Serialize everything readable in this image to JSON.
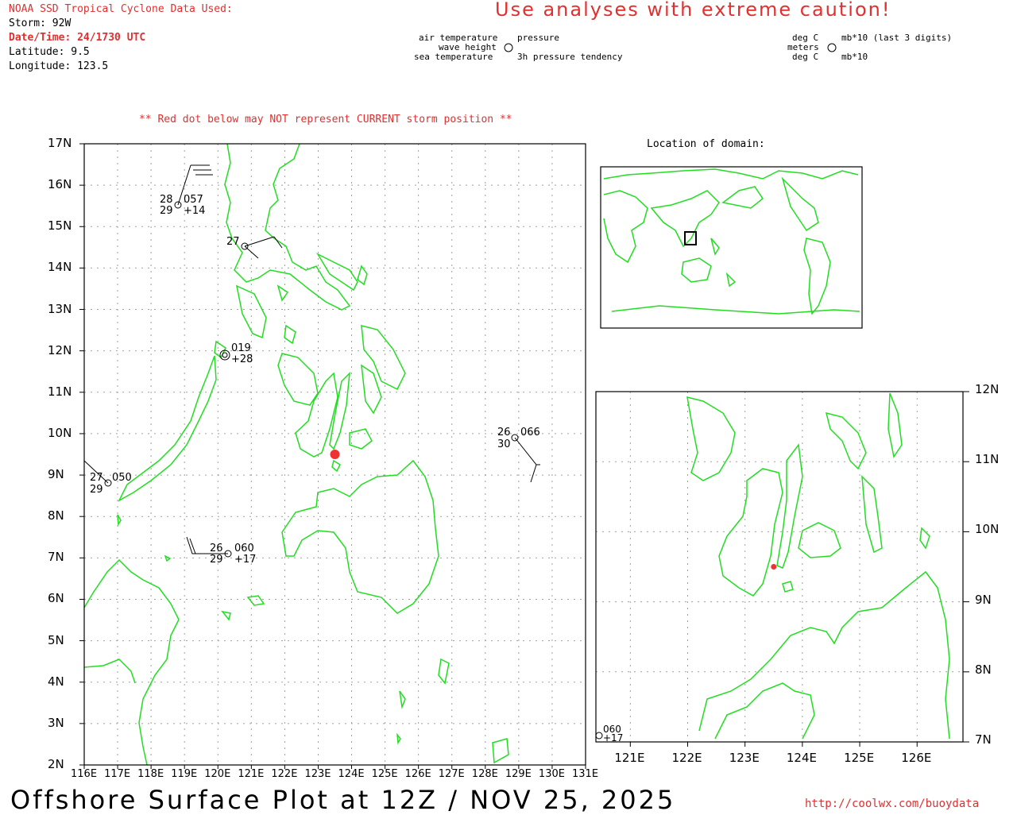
{
  "header": {
    "data_used": "NOAA SSD Tropical Cyclone Data Used:",
    "storm": "Storm: 92W",
    "datetime": "Date/Time: 24/1730 UTC",
    "latitude": "Latitude: 9.5",
    "longitude": "Longitude: 123.5",
    "caution": "Use analyses with extreme caution!"
  },
  "legend": {
    "air_temperature": "air temperature",
    "wave_height": "wave height",
    "sea_temperature": "sea temperature",
    "pressure": "pressure",
    "pressure_tendency": "3h pressure tendency",
    "units_air": "deg C",
    "units_wave": "meters",
    "units_sea": "deg C",
    "units_pressure": "mb*10 (last 3 digits)",
    "units_tendency": "mb*10"
  },
  "warning": "** Red dot below may NOT represent CURRENT storm position **",
  "main_map": {
    "lat_labels": [
      "17N",
      "16N",
      "15N",
      "14N",
      "13N",
      "12N",
      "11N",
      "10N",
      "9N",
      "8N",
      "7N",
      "6N",
      "5N",
      "4N",
      "3N",
      "2N"
    ],
    "lon_labels": [
      "116E",
      "117E",
      "118E",
      "119E",
      "120E",
      "121E",
      "122E",
      "123E",
      "124E",
      "125E",
      "126E",
      "127E",
      "128E",
      "129E",
      "130E",
      "131E"
    ],
    "storm_position": {
      "lat": 9.5,
      "lon": 123.5
    },
    "observations": [
      {
        "air": "28",
        "pressure": "057",
        "sea": "29",
        "tendency": "+14"
      },
      {
        "air": "27",
        "pressure": "",
        "sea": "",
        "tendency": ""
      },
      {
        "air": "",
        "pressure": "019",
        "sea": "",
        "tendency": "+28"
      },
      {
        "air": "26",
        "pressure": "066",
        "sea": "30",
        "tendency": ""
      },
      {
        "air": "27",
        "pressure": "050",
        "sea": "29",
        "tendency": ""
      },
      {
        "air": "26",
        "pressure": "060",
        "sea": "29",
        "tendency": "+17"
      }
    ]
  },
  "inset_location": {
    "title": "Location of domain:"
  },
  "zoom_map": {
    "lat_labels": [
      "12N",
      "11N",
      "10N",
      "9N",
      "8N",
      "7N"
    ],
    "lon_labels": [
      "121E",
      "122E",
      "123E",
      "124E",
      "125E",
      "126E"
    ],
    "observation": {
      "pressure": "060",
      "tendency": "+17"
    }
  },
  "footer": {
    "title": "Offshore Surface Plot at 12Z / NOV 25, 2025",
    "url": "http://coolwx.com/buoydata"
  },
  "colors": {
    "coastline": "#22dd22",
    "storm_dot": "#ee3333",
    "warning_text": "#e03030"
  }
}
